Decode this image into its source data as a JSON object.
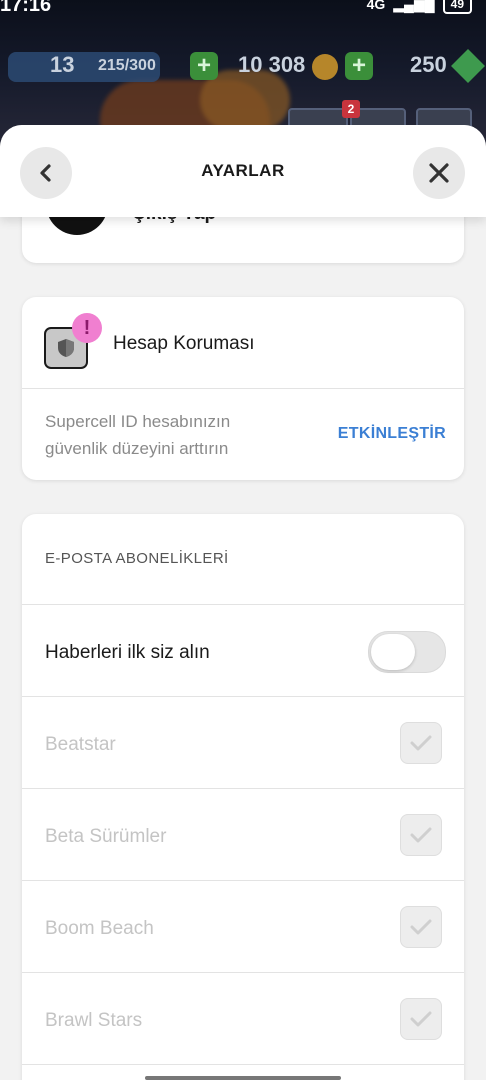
{
  "status_bar": {
    "time": "17:16",
    "network": "4G",
    "battery": "49"
  },
  "game_hud": {
    "level": "13",
    "xp": "215/300",
    "coins": "10 308",
    "gems": "250",
    "notification_count": "2"
  },
  "header": {
    "title": "AYARLAR",
    "back_icon": "chevron-left-icon",
    "close_icon": "close-icon"
  },
  "logout_card": {
    "label": "Çıkış Yap"
  },
  "protection_card": {
    "title": "Hesap Koruması",
    "alert_glyph": "!",
    "description_line1": "Supercell ID hesabınızın",
    "description_line2": "güvenlik düzeyini arttırın",
    "action": "ETKİNLEŞTİR"
  },
  "subscriptions": {
    "header": "E-POSTA ABONELİKLERİ",
    "news_label": "Haberleri ilk siz alın",
    "items": [
      {
        "label": "Beatstar"
      },
      {
        "label": "Beta Sürümler"
      },
      {
        "label": "Boom Beach"
      },
      {
        "label": "Brawl Stars"
      }
    ]
  },
  "colors": {
    "accent_blue": "#3b7fd4",
    "alert_pink": "#f07fd0",
    "muted_text": "#c4c4c4"
  }
}
